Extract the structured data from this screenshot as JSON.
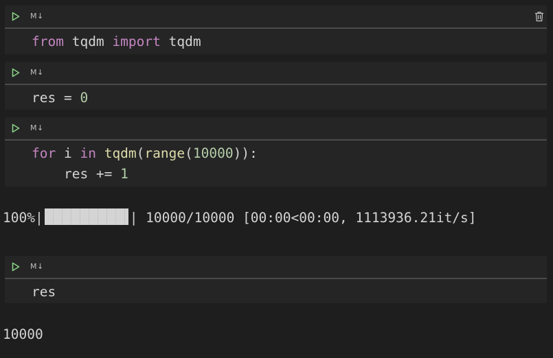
{
  "cells": [
    {
      "label": "M↓",
      "code": [
        [
          [
            "kw",
            "from"
          ],
          [
            "plain",
            " tqdm "
          ],
          [
            "kw",
            "import"
          ],
          [
            "plain",
            " tqdm"
          ]
        ]
      ]
    },
    {
      "label": "M↓",
      "code": [
        [
          [
            "plain",
            "res = "
          ],
          [
            "num",
            "0"
          ]
        ]
      ]
    },
    {
      "label": "M↓",
      "code": [
        [
          [
            "kw",
            "for"
          ],
          [
            "plain",
            " i "
          ],
          [
            "kw",
            "in"
          ],
          [
            "plain",
            " "
          ],
          [
            "fn",
            "tqdm"
          ],
          [
            "plain",
            "("
          ],
          [
            "fn",
            "range"
          ],
          [
            "plain",
            "("
          ],
          [
            "num",
            "10000"
          ],
          [
            "plain",
            "))"
          ],
          [
            "plain",
            ":"
          ]
        ],
        [
          [
            "plain",
            "    res += "
          ],
          [
            "num",
            "1"
          ]
        ]
      ]
    },
    {
      "label": "M↓",
      "code": [
        [
          [
            "plain",
            "res"
          ]
        ]
      ]
    }
  ],
  "progress": {
    "percent_label": "100%|",
    "fraction": 1.0,
    "suffix": "| 10000/10000 [00:00<00:00, 1113936.21it/s]"
  },
  "result_output": "10000",
  "icons": {
    "run": "run-icon",
    "trash": "trash-icon"
  },
  "colors": {
    "keyword": "#c586c0",
    "function": "#dcdcaa",
    "number": "#b5cea8",
    "run": "#89d185"
  }
}
